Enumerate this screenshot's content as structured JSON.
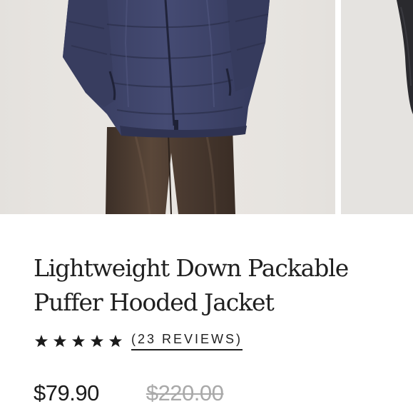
{
  "carousel": {
    "images": [
      {
        "alt": "product-photo-front",
        "icon": "product-image"
      },
      {
        "alt": "product-photo-alt",
        "icon": "product-image"
      }
    ]
  },
  "product": {
    "title": "Lightweight Down Packable Puffer Hooded Jacket",
    "rating": {
      "stars": 5,
      "max_stars": 5,
      "reviews_label": "(23 REVIEWS)"
    },
    "price": {
      "sale": "$79.90",
      "original": "$220.00"
    }
  },
  "colors": {
    "text": "#1f1f1f",
    "strikethrough_price": "#a9a9a9",
    "jacket": "#3a3f63",
    "pants": "#4a3a30",
    "background": "#ffffff"
  }
}
